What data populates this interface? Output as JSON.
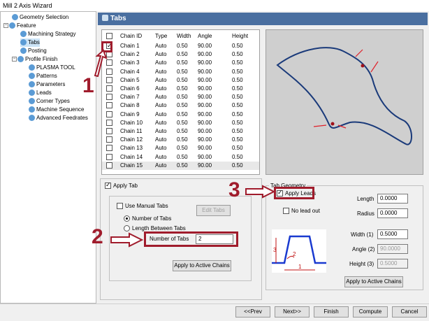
{
  "window": {
    "title": "Mill 2 Axis Wizard"
  },
  "tree": {
    "items": [
      {
        "label": "Geometry Selection",
        "indent": 1,
        "expander": false
      },
      {
        "label": "Feature",
        "indent": 0,
        "expander": true
      },
      {
        "label": "Machining Strategy",
        "indent": 2,
        "expander": false
      },
      {
        "label": "Tabs",
        "indent": 2,
        "expander": false,
        "selected": true
      },
      {
        "label": "Posting",
        "indent": 2,
        "expander": false
      },
      {
        "label": "Profile Finish",
        "indent": 1,
        "expander": true
      },
      {
        "label": "PLASMA TOOL",
        "indent": 3,
        "expander": false
      },
      {
        "label": "Patterns",
        "indent": 3,
        "expander": false
      },
      {
        "label": "Parameters",
        "indent": 3,
        "expander": false
      },
      {
        "label": "Leads",
        "indent": 3,
        "expander": false
      },
      {
        "label": "Corner Types",
        "indent": 3,
        "expander": false
      },
      {
        "label": "Machine Sequence",
        "indent": 3,
        "expander": false
      },
      {
        "label": "Advanced Feedrates",
        "indent": 3,
        "expander": false
      }
    ]
  },
  "header": {
    "title": "Tabs"
  },
  "table": {
    "columns": [
      "Chain ID",
      "Type",
      "Width",
      "Angle",
      "Height"
    ],
    "rows": [
      [
        "Chain 1",
        "Auto",
        "0.50",
        "90.00",
        "0.50"
      ],
      [
        "Chain 2",
        "Auto",
        "0.50",
        "90.00",
        "0.50"
      ],
      [
        "Chain 3",
        "Auto",
        "0.50",
        "90.00",
        "0.50"
      ],
      [
        "Chain 4",
        "Auto",
        "0.50",
        "90.00",
        "0.50"
      ],
      [
        "Chain 5",
        "Auto",
        "0.50",
        "90.00",
        "0.50"
      ],
      [
        "Chain 6",
        "Auto",
        "0.50",
        "90.00",
        "0.50"
      ],
      [
        "Chain 7",
        "Auto",
        "0.50",
        "90.00",
        "0.50"
      ],
      [
        "Chain 8",
        "Auto",
        "0.50",
        "90.00",
        "0.50"
      ],
      [
        "Chain 9",
        "Auto",
        "0.50",
        "90.00",
        "0.50"
      ],
      [
        "Chain 10",
        "Auto",
        "0.50",
        "90.00",
        "0.50"
      ],
      [
        "Chain 11",
        "Auto",
        "0.50",
        "90.00",
        "0.50"
      ],
      [
        "Chain 12",
        "Auto",
        "0.50",
        "90.00",
        "0.50"
      ],
      [
        "Chain 13",
        "Auto",
        "0.50",
        "90.00",
        "0.50"
      ],
      [
        "Chain 14",
        "Auto",
        "0.50",
        "90.00",
        "0.50"
      ],
      [
        "Chain 15",
        "Auto",
        "0.50",
        "90.00",
        "0.50"
      ]
    ],
    "checked": [
      true,
      false,
      false,
      false,
      false,
      false,
      false,
      false,
      false,
      false,
      false,
      false,
      false,
      false,
      false
    ]
  },
  "apply_tab": {
    "label": "Apply Tab",
    "checked": true
  },
  "left_panel": {
    "use_manual_tabs": "Use Manual Tabs",
    "edit_tabs": "Edit Tabs",
    "number_of_tabs_radio": "Number of Tabs",
    "length_between_tabs": "Length Between Tabs",
    "number_of_tabs_label": "Number of Tabs",
    "number_of_tabs_value": "2",
    "apply_active": "Apply to Active Chains"
  },
  "tab_geometry": {
    "title": "Tab Geometry",
    "apply_leads": "Apply Leads",
    "no_lead_out": "No lead out",
    "length_label": "Length",
    "length_value": "0.0000",
    "radius_label": "Radius",
    "radius_value": "0.0000",
    "width_label": "Width (1)",
    "width_value": "0.5000",
    "angle_label": "Angle (2)",
    "angle_value": "90.0000",
    "height_label": "Height (3)",
    "height_value": "0.5000",
    "apply_active": "Apply to Active Chains",
    "diagram_labels": [
      "1",
      "2",
      "3"
    ]
  },
  "annotations": [
    "1",
    "2",
    "3"
  ],
  "buttons": {
    "prev": "<<Prev",
    "next": "Next>>",
    "finish": "Finish",
    "compute": "Compute",
    "cancel": "Cancel"
  },
  "colors": {
    "header": "#4a6fa0",
    "annotation": "#a01c2c",
    "geometry": "#1a3a7a",
    "tab_marker": "#e0202a"
  }
}
